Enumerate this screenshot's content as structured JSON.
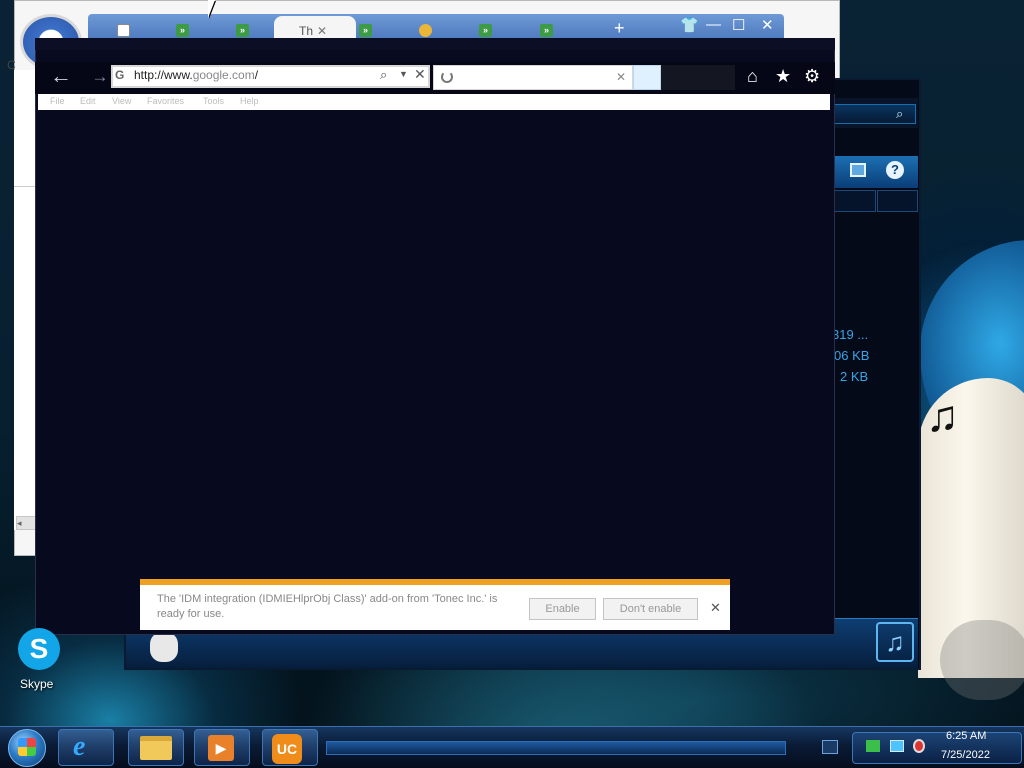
{
  "background_window": {
    "tab_active_label": "Th",
    "tab_close": "✕",
    "new_tab_symbol": "+",
    "controls": {
      "restore": "👕",
      "minimize": "—",
      "maximize": "☐",
      "close": "✕"
    },
    "left_letter": "C"
  },
  "media_player": {
    "file_sizes": [
      "319 ...",
      "06 KB",
      "2 KB"
    ],
    "help_symbol": "?"
  },
  "ie": {
    "address": {
      "prefix": "http://www.",
      "host": "google.com",
      "suffix": "/"
    },
    "addr_icon": "G",
    "menu": [
      "File",
      "Edit",
      "View",
      "Favorites",
      "Tools",
      "Help"
    ],
    "notification": {
      "message": "The 'IDM integration (IDMIEHlprObj Class)' add-on from 'Tonec Inc.' is ready for use.",
      "enable_label": "Enable",
      "dont_enable_label": "Don't enable",
      "close_symbol": "✕"
    }
  },
  "desktop": {
    "icons": [
      {
        "label": "Skype"
      }
    ]
  },
  "taskbar": {
    "clock_time": "6:25 AM",
    "clock_date": "7/25/2022"
  },
  "colors": {
    "taskbar": "#0a1b36",
    "ie_frame": "#080a1f",
    "notif_accent": "#f0a020",
    "skype": "#12a6e8"
  }
}
